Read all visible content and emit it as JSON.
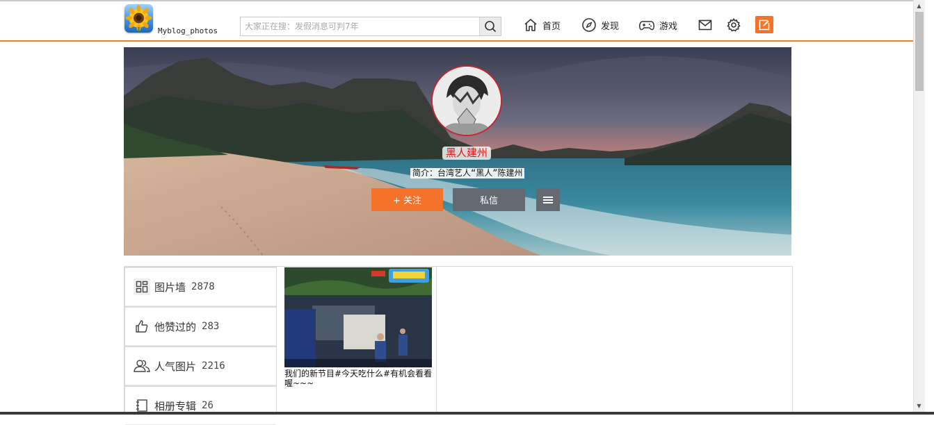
{
  "header": {
    "site_name": "Myblog_photos",
    "search_placeholder": "大家正在搜：发假消息可判7年",
    "nav": [
      {
        "label": "首页",
        "icon": "home-icon"
      },
      {
        "label": "发现",
        "icon": "compass-icon"
      },
      {
        "label": "游戏",
        "icon": "gamepad-icon"
      }
    ],
    "icons": [
      "mail-icon",
      "gear-icon",
      "compose-icon"
    ]
  },
  "profile": {
    "name": "黑人建州",
    "intro": "简介：台湾艺人“黑人”陈建州",
    "follow_label": "+ 关注",
    "message_label": "私信",
    "more_icon": "menu-icon"
  },
  "sidebar": {
    "items": [
      {
        "label": "图片墙",
        "count": "2878",
        "icon": "grid-icon"
      },
      {
        "label": "他赞过的",
        "count": "283",
        "icon": "thumbs-up-icon"
      },
      {
        "label": "人气图片",
        "count": "2216",
        "icon": "users-icon"
      },
      {
        "label": "相册专辑",
        "count": "26",
        "icon": "album-icon"
      }
    ]
  },
  "posts": [
    {
      "caption": "我们的新节目#今天吃什么#有机会看看喔~~~"
    }
  ],
  "colors": {
    "accent_orange": "#f5722a",
    "header_rule": "#f07d1e",
    "button_gray": "#646972",
    "name_red": "#d21d1d",
    "avatar_border": "#c1272d"
  }
}
